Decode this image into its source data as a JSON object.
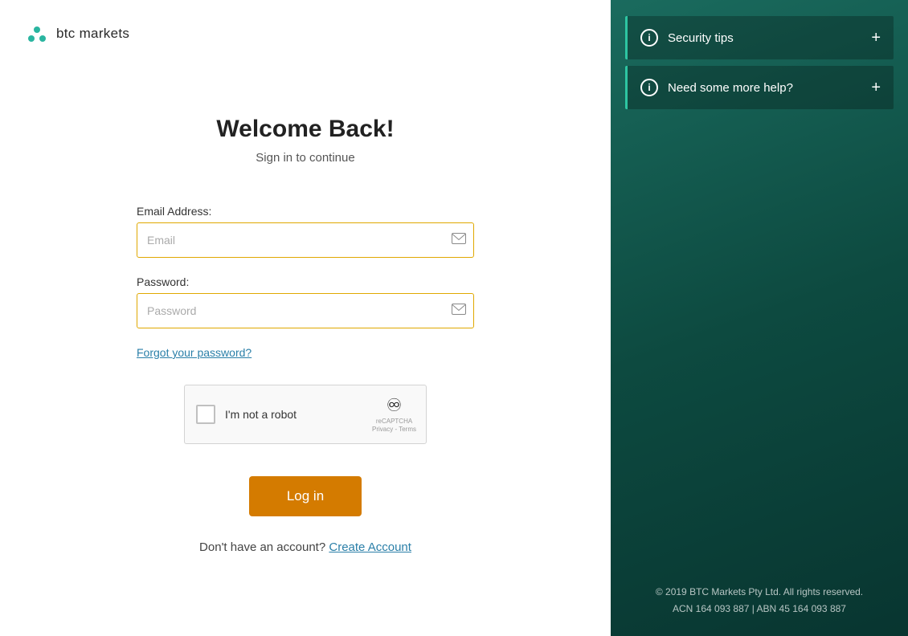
{
  "logo": {
    "text": "btc markets"
  },
  "form": {
    "title": "Welcome Back!",
    "subtitle": "Sign in to continue",
    "email_label": "Email Address:",
    "email_placeholder": "Email",
    "password_label": "Password:",
    "password_placeholder": "Password",
    "forgot_password": "Forgot your password?",
    "recaptcha_label": "I'm not a robot",
    "recaptcha_brand": "reCAPTCHA\nPrivacy - Terms",
    "login_button": "Log in",
    "no_account_text": "Don't have an account?",
    "create_account_link": "Create Account"
  },
  "right_panel": {
    "accordion_items": [
      {
        "title": "Security tips",
        "expanded": false
      },
      {
        "title": "Need some more help?",
        "expanded": false
      }
    ],
    "footer": {
      "line1": "© 2019 BTC Markets Pty Ltd. All rights reserved.",
      "line2": "ACN 164 093 887 | ABN 45 164 093 887"
    }
  }
}
